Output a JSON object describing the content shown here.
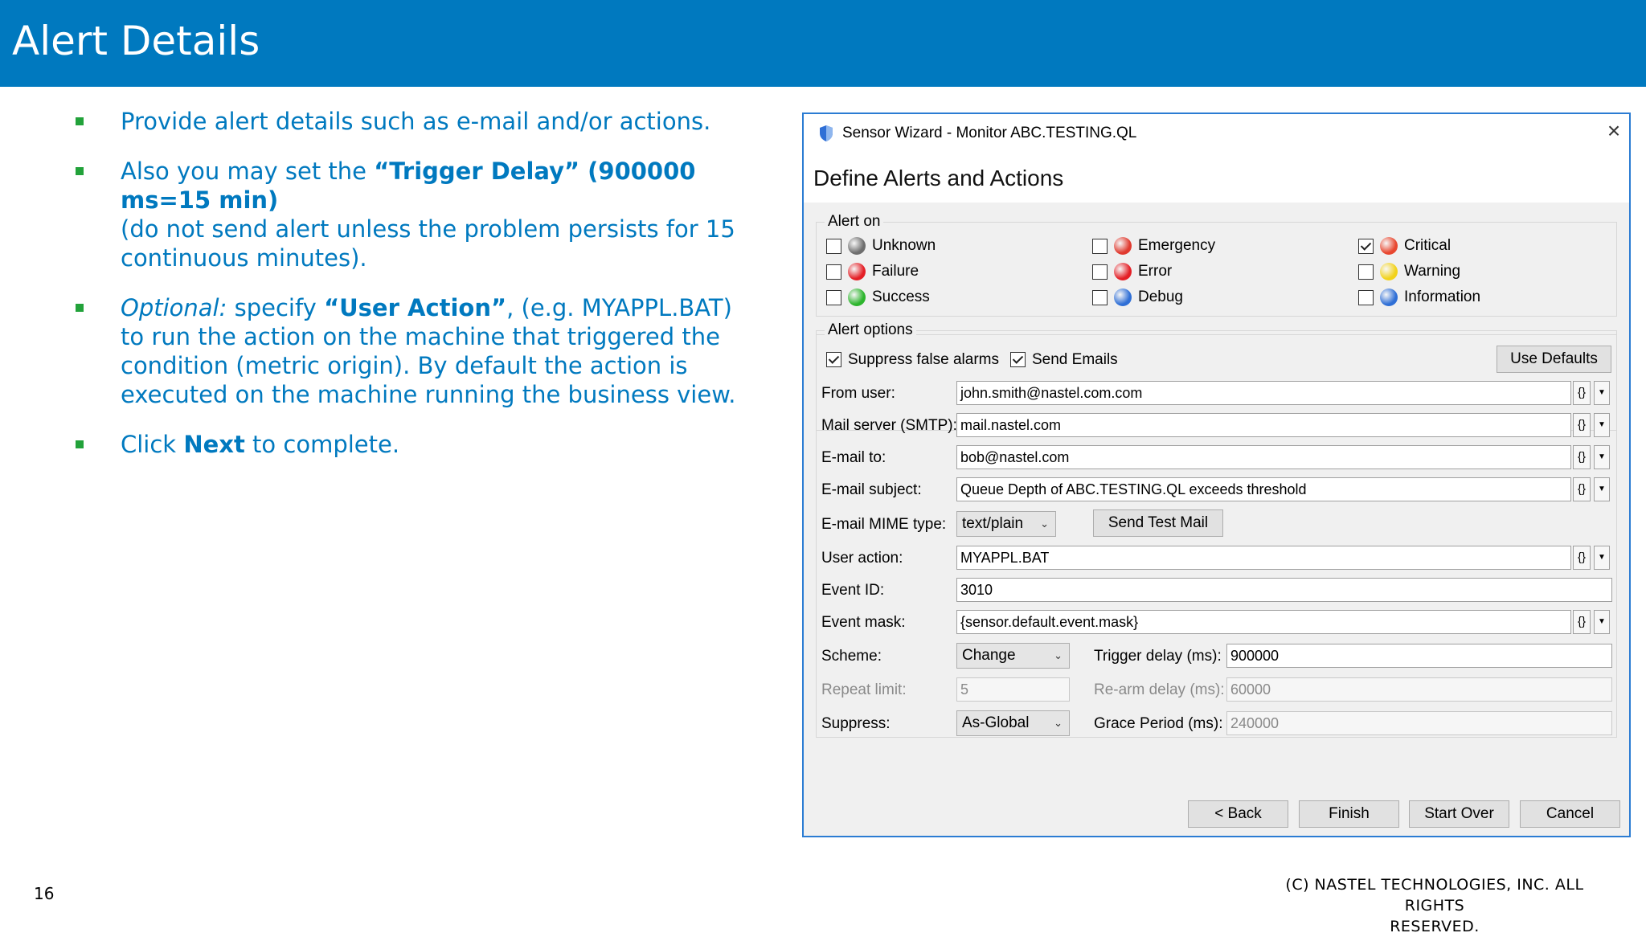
{
  "slide": {
    "title": "Alert Details",
    "page_number": "16",
    "copyright_line1": "(C) NASTEL TECHNOLOGIES, INC. ALL RIGHTS",
    "copyright_line2": "RESERVED."
  },
  "bullets": {
    "b1": "Provide alert details such as e-mail and/or actions.",
    "b2_pre": "Also you may set the ",
    "b2_bold": "“Trigger Delay” (900000 ms=15 min)",
    "b2_line2": "(do not send alert unless the problem persists for 15 continuous minutes).",
    "b3_italic": "Optional:",
    "b3_mid": " specify ",
    "b3_bold": "“User Action”",
    "b3_rest": ", (e.g. MYAPPL.BAT) to run the action on the machine that triggered the condition (metric origin). By default the action is executed on the machine running the business view.",
    "b4_pre": "Click ",
    "b4_bold": "Next",
    "b4_post": " to complete."
  },
  "dialog": {
    "title": "Sensor Wizard - Monitor ABC.TESTING.QL",
    "close_glyph": "×",
    "heading": "Define Alerts and Actions",
    "alert_on": {
      "label": "Alert on",
      "items": [
        {
          "label": "Unknown",
          "checked": false,
          "color": "#6e6e6e"
        },
        {
          "label": "Emergency",
          "checked": false,
          "color": "#e03a2f"
        },
        {
          "label": "Critical",
          "checked": true,
          "color": "#e8472f"
        },
        {
          "label": "Failure",
          "checked": false,
          "color": "#e41f26"
        },
        {
          "label": "Error",
          "checked": false,
          "color": "#e41f26"
        },
        {
          "label": "Warning",
          "checked": false,
          "color": "#f2d21b"
        },
        {
          "label": "Success",
          "checked": false,
          "color": "#2db52d"
        },
        {
          "label": "Debug",
          "checked": false,
          "color": "#2f6fd6"
        },
        {
          "label": "Information",
          "checked": false,
          "color": "#2f6fd6"
        }
      ]
    },
    "alert_options": {
      "label": "Alert options",
      "suppress_false_alarms": "Suppress false alarms",
      "send_emails": "Send Emails",
      "use_defaults": "Use Defaults",
      "var_glyph": "{}",
      "drop_glyph": "▼",
      "from_user_label": "From user:",
      "from_user_value": "john.smith@nastel.com.com",
      "mail_server_label": "Mail server (SMTP):",
      "mail_server_value": "mail.nastel.com",
      "email_to_label": "E-mail to:",
      "email_to_value": "bob@nastel.com",
      "email_subject_label": "E-mail subject:",
      "email_subject_value": "Queue Depth of ABC.TESTING.QL exceeds threshold",
      "mime_label": "E-mail MIME type:",
      "mime_value": "text/plain",
      "send_test_mail": "Send Test Mail",
      "user_action_label": "User action:",
      "user_action_value": "MYAPPL.BAT",
      "event_id_label": "Event ID:",
      "event_id_value": "3010",
      "event_mask_label": "Event mask:",
      "event_mask_value": "{sensor.default.event.mask}",
      "scheme_label": "Scheme:",
      "scheme_value": "Change",
      "trigger_delay_label": "Trigger delay (ms):",
      "trigger_delay_value": "900000",
      "repeat_limit_label": "Repeat limit:",
      "repeat_limit_value": "5",
      "rearm_delay_label": "Re-arm delay (ms):",
      "rearm_delay_value": "60000",
      "suppress_label": "Suppress:",
      "suppress_value": "As-Global",
      "grace_period_label": "Grace Period (ms):",
      "grace_period_value": "240000"
    },
    "buttons": {
      "back": "< Back",
      "finish": "Finish",
      "start_over": "Start Over",
      "cancel": "Cancel"
    }
  }
}
